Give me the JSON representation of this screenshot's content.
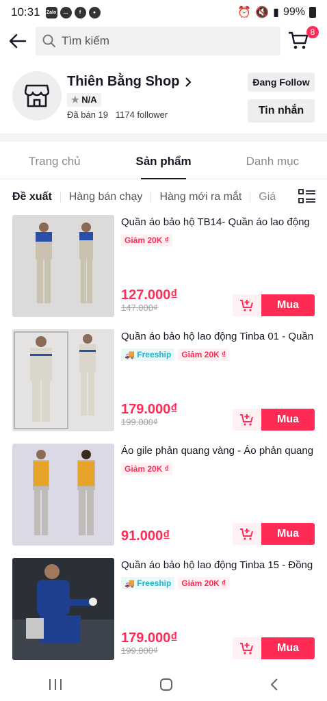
{
  "status_bar": {
    "time": "10:31",
    "battery": "99%",
    "app_icons": [
      "zalo-icon",
      "chat-icon",
      "facebook-icon",
      "location-icon"
    ]
  },
  "search": {
    "placeholder": "Tìm kiếm"
  },
  "cart": {
    "badge": "8"
  },
  "shop": {
    "name": "Thiên Bằng Shop",
    "rating": "N/A",
    "sold": "Đã bán 19",
    "followers": "1174 follower",
    "follow_label": "Đang Follow",
    "message_label": "Tin nhắn"
  },
  "tabs": [
    "Trang chủ",
    "Sản phẩm",
    "Danh mục"
  ],
  "filters": [
    "Đề xuất",
    "Hàng bán chạy",
    "Hàng mới ra mắt",
    "Giá"
  ],
  "products": [
    {
      "name": "Quần áo bảo hộ TB14- Quần áo lao động",
      "tags": [
        {
          "type": "disc",
          "label": "Giảm 20K ₫"
        }
      ],
      "price": "127.000₫",
      "old_price": "147.000₫",
      "buy_label": "Mua"
    },
    {
      "name": "Quần áo bảo hộ lao động Tinba 01 - Quần",
      "tags": [
        {
          "type": "free",
          "label": "Freeship"
        },
        {
          "type": "disc",
          "label": "Giảm 20K ₫"
        }
      ],
      "price": "179.000₫",
      "old_price": "199.000₫",
      "buy_label": "Mua"
    },
    {
      "name": "Áo gile phản quang vàng - Áo phản quang",
      "tags": [
        {
          "type": "disc",
          "label": "Giảm 20K ₫"
        }
      ],
      "price": "91.000₫",
      "old_price": "",
      "buy_label": "Mua"
    },
    {
      "name": "Quần áo bảo hộ lao động Tinba 15 - Đồng",
      "tags": [
        {
          "type": "free",
          "label": "Freeship"
        },
        {
          "type": "disc",
          "label": "Giảm 20K ₫"
        }
      ],
      "price": "179.000₫",
      "old_price": "199.000₫",
      "buy_label": "Mua"
    }
  ],
  "colors": {
    "accent": "#fe2c55",
    "freeship": "#20b3c3"
  }
}
